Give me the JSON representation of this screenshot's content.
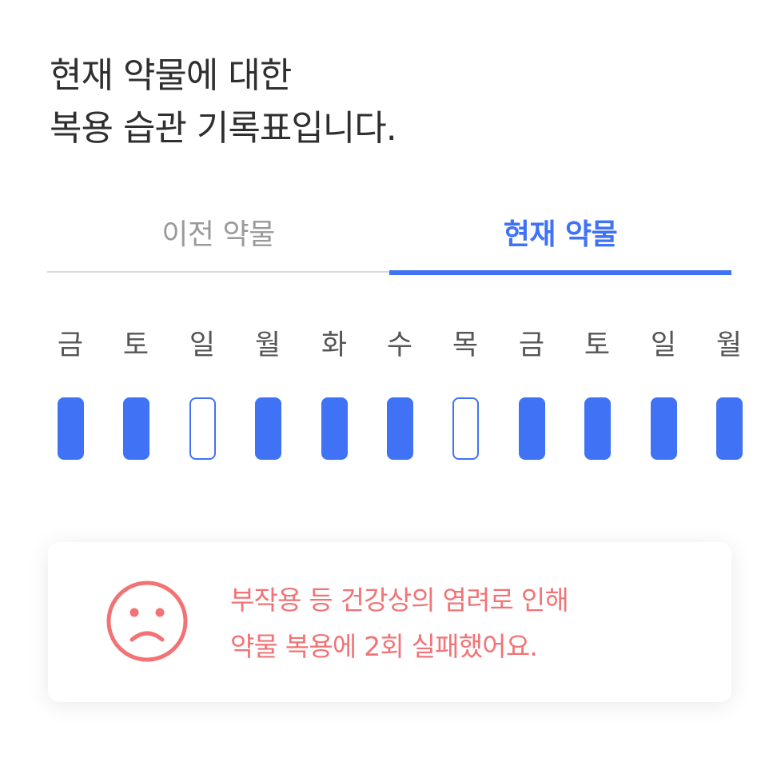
{
  "headline": {
    "line1": "현재 약물에 대한",
    "line2": "복용 습관 기록표입니다."
  },
  "tabs": [
    {
      "label": "이전 약물",
      "active": false
    },
    {
      "label": "현재 약물",
      "active": true
    }
  ],
  "days": [
    {
      "label": "금",
      "status": "taken"
    },
    {
      "label": "토",
      "status": "taken"
    },
    {
      "label": "일",
      "status": "missed"
    },
    {
      "label": "월",
      "status": "taken"
    },
    {
      "label": "화",
      "status": "taken"
    },
    {
      "label": "수",
      "status": "taken"
    },
    {
      "label": "목",
      "status": "missed"
    },
    {
      "label": "금",
      "status": "taken"
    },
    {
      "label": "토",
      "status": "taken"
    },
    {
      "label": "일",
      "status": "taken"
    },
    {
      "label": "월",
      "status": "taken"
    }
  ],
  "alert": {
    "icon": "sad-face-icon",
    "line1": "부작용 등 건강상의 염려로 인해",
    "line2": "약물 복용에 2회 실패했어요."
  },
  "colors": {
    "accent": "#3f72f5",
    "warning": "#f17376",
    "text": "#2f2f2f"
  }
}
